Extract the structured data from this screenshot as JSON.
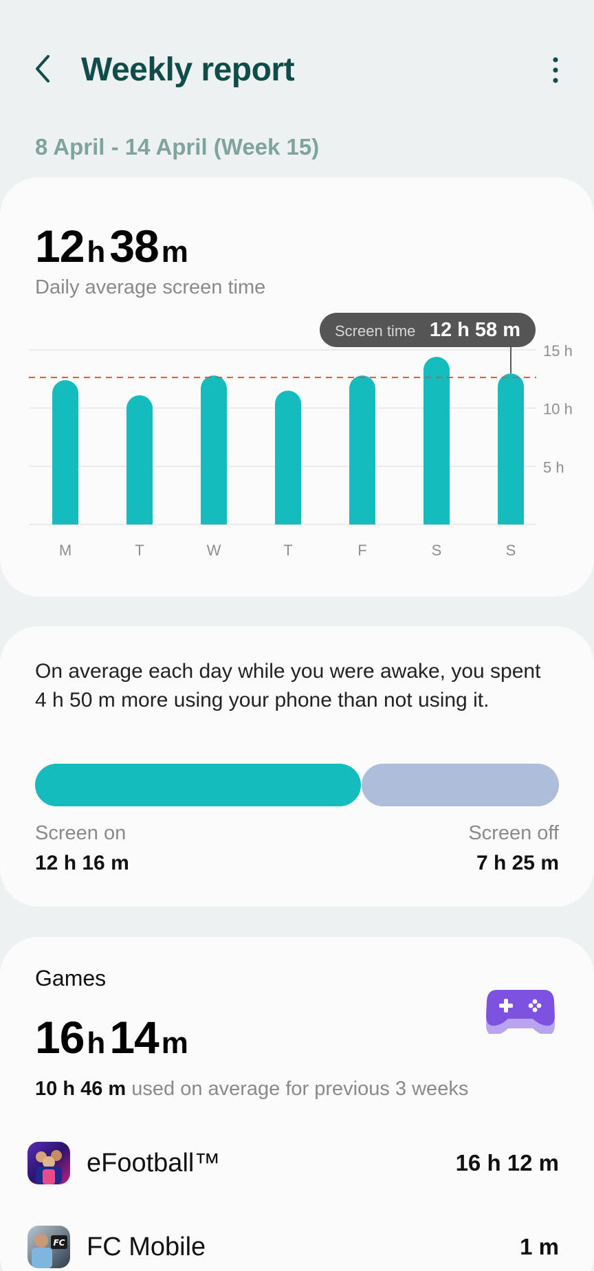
{
  "header": {
    "title": "Weekly report",
    "back_icon": "chevron-left-icon",
    "more_icon": "more-vertical-icon"
  },
  "date_range": "8 April - 14 April (Week 15)",
  "summary": {
    "hours": "12",
    "hours_unit": "h",
    "minutes": "38",
    "minutes_unit": "m",
    "label": "Daily average screen time"
  },
  "tooltip": {
    "label": "Screen time",
    "value": "12 h 58 m"
  },
  "chart_data": {
    "type": "bar",
    "categories": [
      "M",
      "T",
      "W",
      "T",
      "F",
      "S",
      "S"
    ],
    "values": [
      12.4,
      11.1,
      12.8,
      11.5,
      12.8,
      14.4,
      12.97
    ],
    "ylim": [
      0,
      15
    ],
    "y_ticks": [
      5,
      10,
      15
    ],
    "y_tick_labels": [
      "5 h",
      "10 h",
      "15 h"
    ],
    "average_line": 12.63,
    "grid": true,
    "bar_color": "#15bcbe",
    "average_color": "#e0524a",
    "selected_index": 6
  },
  "usage_compare": {
    "text": "On average each day while you were awake, you spent 4 h 50 m more using your phone than not using it.",
    "screen_on_label": "Screen on",
    "screen_on_value": "12 h 16 m",
    "screen_off_label": "Screen off",
    "screen_off_value": "7 h 25 m",
    "screen_on_fraction": 0.623,
    "on_color": "#15bcbe",
    "off_color": "#aebdda"
  },
  "games": {
    "title": "Games",
    "icon": "gamepad-icon",
    "hours": "16",
    "hours_unit": "h",
    "minutes": "14",
    "minutes_unit": "m",
    "prev_value": "10 h 46 m",
    "prev_text": "used on average for previous 3 weeks",
    "apps": [
      {
        "name": "eFootball™",
        "time": "16 h 12 m",
        "icon": "efootball-app-icon"
      },
      {
        "name": "FC Mobile",
        "time": "1 m",
        "icon": "fc-mobile-app-icon"
      }
    ]
  }
}
